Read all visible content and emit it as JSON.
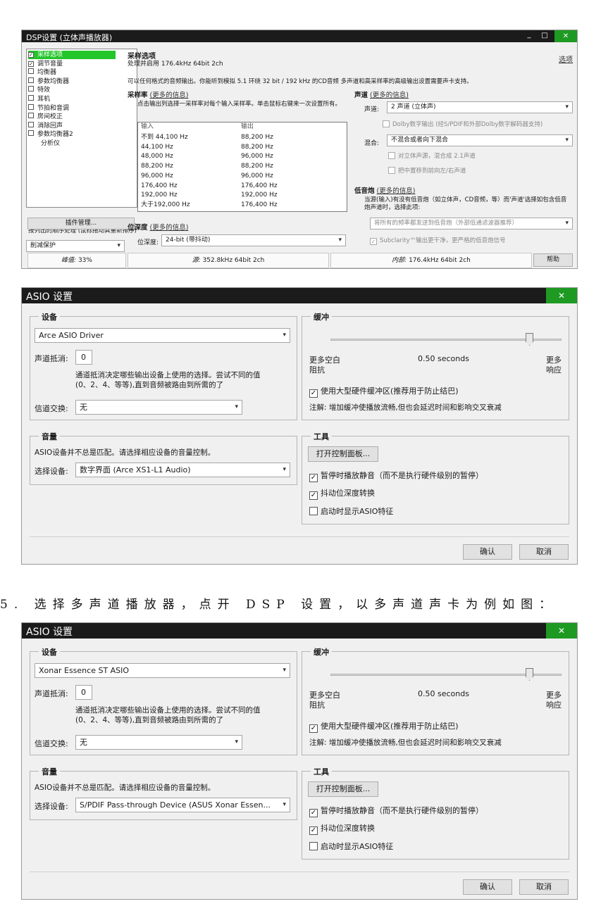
{
  "dsp": {
    "title": "DSP设置 (立体声播放器)",
    "close_glyph": "✕",
    "min_glyph": "_",
    "max_glyph": "□",
    "list": [
      {
        "label": "采样选项",
        "checked": true,
        "selected": true
      },
      {
        "label": "调节音量",
        "checked": true
      },
      {
        "label": "均衡器",
        "checked": false
      },
      {
        "label": "参数均衡器",
        "checked": false
      },
      {
        "label": "特效",
        "checked": false
      },
      {
        "label": "耳机",
        "checked": false
      },
      {
        "label": "节拍和音调",
        "checked": false
      },
      {
        "label": "房间校正",
        "checked": false
      },
      {
        "label": "消除回声",
        "checked": false
      },
      {
        "label": "参数均衡器2",
        "checked": false
      },
      {
        "label": "分析仪",
        "noBox": true
      }
    ],
    "order_note": "按列出的顺序处理 (鼠标拖动其重新排序)",
    "plugin_button": "插件管理...",
    "clip_combo": "削减保护",
    "section_title": "采样选项",
    "section_sub": "处理并启用 176.4kHz 64bit 2ch",
    "options_link": "选项",
    "desc": "可以任何格式的音频输出。你能听到模拟 5.1 环绕 32 bit / 192 kHz 的CD音频  多声道和高采样率的高级输出设置需要声卡支持。",
    "rate_label": "采样率",
    "more_info": "(更多的信息)",
    "rate_desc": "点击输出列选择一采样率对每个输入采样率。单击鼠标右键来一次设置所有。",
    "rate_head_in": "输入",
    "rate_head_out": "输出",
    "rates": [
      {
        "in": "不到 44,100 Hz",
        "out": "88,200 Hz"
      },
      {
        "in": "44,100 Hz",
        "out": "88,200 Hz"
      },
      {
        "in": "48,000 Hz",
        "out": "96,000 Hz"
      },
      {
        "in": "88,200 Hz",
        "out": "88,200 Hz"
      },
      {
        "in": "96,000 Hz",
        "out": "96,000 Hz"
      },
      {
        "in": "176,400 Hz",
        "out": "176,400 Hz"
      },
      {
        "in": "192,000 Hz",
        "out": "192,000 Hz"
      },
      {
        "in": "大于192,000 Hz",
        "out": "176,400 Hz"
      }
    ],
    "bitdepth_label": "位深度",
    "bitdepth_field": "位深度:",
    "bitdepth_value": "24-bit (带抖动)",
    "channel_label": "声道",
    "channel_field": "声道:",
    "channel_value": "2 声道 (立体声)",
    "dolby_label": "Dolby数字输出 (经S/PDIF和外部Dolby数字解码器支持)",
    "mix_field": "混合:",
    "mix_value": "不混合或者向下混合",
    "stereo_mix": "对立体声源，混合成 2.1声道",
    "center_mix": "把中置移到前向左/右声道",
    "bass_label": "低音炮",
    "bass_desc": "当源(输入)有没有低音炮（如立体声，CD音频，等）而'声道'选择如包含低音炮声道时，选择此项:",
    "bass_combo": "将所有的频率都发送到低音炮（外部低通滤波器推荐）",
    "subclarity": "Subclarity™输出更干净，更严格的低音炮信号",
    "status_peak_label": "峰值:",
    "status_peak": "33%",
    "status_src_label": "源:",
    "status_src": "352.8kHz 64bit 2ch",
    "status_int_label": "内部:",
    "status_int": "176.4kHz 64bit 2ch",
    "help_button": "帮助"
  },
  "asio": [
    {
      "title": "ASIO 设置",
      "close_glyph": "✕",
      "device_group": "设备",
      "device": "Arce ASIO Driver",
      "cancel_label": "声道抵消:",
      "cancel_value": "0",
      "cancel_desc1": "通道抵消决定哪些输出设备上使用的选择。尝试不同的值",
      "cancel_desc2": "(0、2、4、等等),直到音频被路由到所需的了",
      "swap_label": "信道交换:",
      "swap_value": "无",
      "buffer_group": "缓冲",
      "buffer_value": 0.86,
      "buffer_left1": "更多空白",
      "buffer_left2": "阻抗",
      "buffer_center": "0.50 seconds",
      "buffer_right1": "更多",
      "buffer_right2": "响应",
      "big_buffer": "使用大型硬件缓冲区(推荐用于防止结巴)",
      "note": "注解: 增加缓冲使播放流畅,但也会延迟时间和影响交叉衰减",
      "volume_group": "音量",
      "volume_desc": "ASIO设备并不总是匹配。请选择相应设备的音量控制。",
      "select_label": "选择设备:",
      "select_value": "数字界面 (Arce XS1-L1 Audio)",
      "tools_group": "工具",
      "control_panel": "打开控制面板...",
      "opt1": "暂停时播放静音（而不是执行硬件级别的暂停）",
      "opt2": "抖动位深度转换",
      "opt3": "启动时显示ASIO特征",
      "ok": "确认",
      "cancel": "取消"
    },
    {
      "title": "ASIO 设置",
      "close_glyph": "✕",
      "device_group": "设备",
      "device": "Xonar Essence ST ASIO",
      "cancel_label": "声道抵消:",
      "cancel_value": "0",
      "cancel_desc1": "通道抵消决定哪些输出设备上使用的选择。尝试不同的值",
      "cancel_desc2": "(0、2、4、等等),直到音频被路由到所需的了",
      "swap_label": "信道交换:",
      "swap_value": "无",
      "buffer_group": "缓冲",
      "buffer_value": 0.86,
      "buffer_left1": "更多空白",
      "buffer_left2": "阻抗",
      "buffer_center": "0.50 seconds",
      "buffer_right1": "更多",
      "buffer_right2": "响应",
      "big_buffer": "使用大型硬件缓冲区(推荐用于防止结巴)",
      "note": "注解: 增加缓冲使播放流畅,但也会延迟时间和影响交叉衰减",
      "volume_group": "音量",
      "volume_desc": "ASIO设备并不总是匹配。请选择相应设备的音量控制。",
      "select_label": "选择设备:",
      "select_value": "S/PDIF Pass-through Device (ASUS Xonar Essen...",
      "tools_group": "工具",
      "control_panel": "打开控制面板...",
      "opt1": "暂停时播放静音（而不是执行硬件级别的暂停）",
      "opt2": "抖动位深度转换",
      "opt3": "启动时显示ASIO特征",
      "ok": "确认",
      "cancel": "取消"
    }
  ],
  "caption": "5. 选择多声道播放器，点开 DSP 设置，以多声道声卡为例如图：",
  "icons": {
    "check": "✓",
    "arrow": "▾"
  }
}
